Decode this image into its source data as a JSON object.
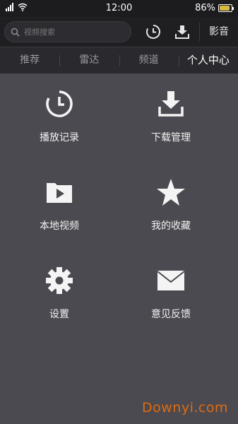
{
  "statusbar": {
    "time": "12:00",
    "battery_text": "86%",
    "battery_level": 0.86
  },
  "toolbar": {
    "search_placeholder": "视频搜索",
    "history_icon": "history-clock-icon",
    "download_icon": "download-tray-icon",
    "brand_label": "影音"
  },
  "tabs": [
    {
      "label": "推荐",
      "active": false
    },
    {
      "label": "雷达",
      "active": false
    },
    {
      "label": "频道",
      "active": false
    },
    {
      "label": "个人中心",
      "active": true
    }
  ],
  "menu": {
    "items": [
      {
        "label": "播放记录",
        "icon": "history-clock-icon"
      },
      {
        "label": "下载管理",
        "icon": "download-tray-icon"
      },
      {
        "label": "本地视频",
        "icon": "video-folder-icon"
      },
      {
        "label": "我的收藏",
        "icon": "star-icon"
      },
      {
        "label": "设置",
        "icon": "gear-icon"
      },
      {
        "label": "意见反馈",
        "icon": "envelope-icon"
      }
    ]
  },
  "watermark": "Downyi.com",
  "colors": {
    "background": "#4b4a50",
    "toolbar": "#1f1f22",
    "tabs": "#2a2a2e",
    "watermark": "#e06a10"
  }
}
